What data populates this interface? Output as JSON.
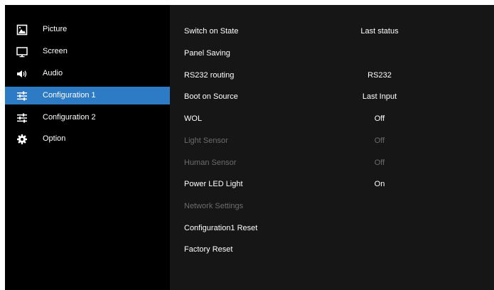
{
  "sidebar": {
    "items": [
      {
        "label": "Picture",
        "icon": "picture-icon",
        "selected": false
      },
      {
        "label": "Screen",
        "icon": "monitor-icon",
        "selected": false
      },
      {
        "label": "Audio",
        "icon": "speaker-icon",
        "selected": false
      },
      {
        "label": "Configuration 1",
        "icon": "sliders-icon",
        "selected": true
      },
      {
        "label": "Configuration 2",
        "icon": "sliders-icon",
        "selected": false
      },
      {
        "label": "Option",
        "icon": "gear-icon",
        "selected": false
      }
    ]
  },
  "settings": {
    "rows": [
      {
        "label": "Switch on State",
        "value": "Last status",
        "enabled": true
      },
      {
        "label": "Panel Saving",
        "value": "",
        "enabled": true
      },
      {
        "label": "RS232 routing",
        "value": "RS232",
        "enabled": true
      },
      {
        "label": "Boot on Source",
        "value": "Last Input",
        "enabled": true
      },
      {
        "label": "WOL",
        "value": "Off",
        "enabled": true
      },
      {
        "label": "Light Sensor",
        "value": "Off",
        "enabled": false
      },
      {
        "label": "Human Sensor",
        "value": "Off",
        "enabled": false
      },
      {
        "label": "Power LED Light",
        "value": "On",
        "enabled": true
      },
      {
        "label": "Network Settings",
        "value": "",
        "enabled": false
      },
      {
        "label": "Configuration1 Reset",
        "value": "",
        "enabled": true
      },
      {
        "label": "Factory Reset",
        "value": "",
        "enabled": true
      }
    ]
  },
  "colors": {
    "selection": "#2d7bc4",
    "sidebar_bg": "#000000",
    "content_bg": "#161616",
    "text": "#ffffff",
    "disabled_text": "#6c6c6c"
  }
}
